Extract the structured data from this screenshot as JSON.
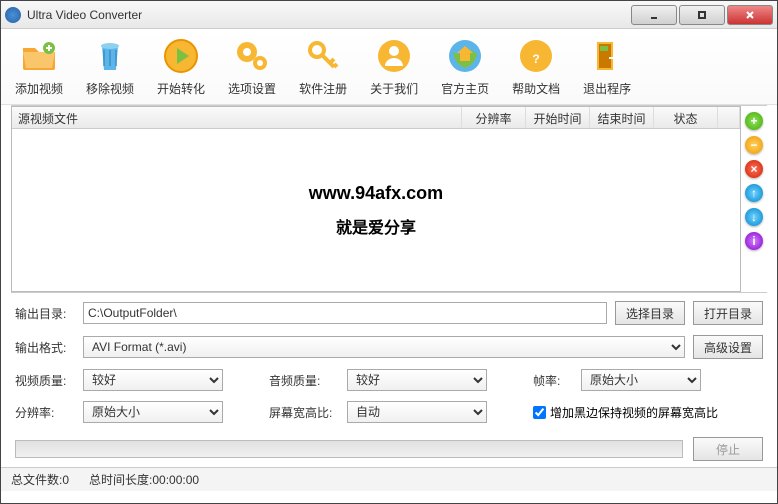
{
  "window": {
    "title": "Ultra Video Converter"
  },
  "toolbar": {
    "add": "添加视频",
    "remove": "移除视频",
    "start": "开始转化",
    "options": "选项设置",
    "register": "软件注册",
    "about": "关于我们",
    "homepage": "官方主页",
    "help": "帮助文档",
    "exit": "退出程序"
  },
  "table": {
    "col_source": "源视频文件",
    "col_res": "分辨率",
    "col_start": "开始时间",
    "col_end": "结束时间",
    "col_status": "状态",
    "watermark1": "www.94afx.com",
    "watermark2": "就是爱分享"
  },
  "sidebuttons": {
    "add": "+",
    "remove": "−",
    "delete": "×",
    "up": "↑",
    "down": "↓",
    "info": "i"
  },
  "form": {
    "outdir_label": "输出目录:",
    "outdir_value": "C:\\OutputFolder\\",
    "browse": "选择目录",
    "open": "打开目录",
    "outfmt_label": "输出格式:",
    "outfmt_value": "AVI Format (*.avi)",
    "advanced": "高级设置",
    "vquality_label": "视频质量:",
    "vquality_value": "较好",
    "aquality_label": "音频质量:",
    "aquality_value": "较好",
    "fps_label": "帧率:",
    "fps_value": "原始大小",
    "res_label": "分辨率:",
    "res_value": "原始大小",
    "aspect_label": "屏幕宽高比:",
    "aspect_value": "自动",
    "padding_label": "增加黑边保持视频的屏幕宽高比",
    "stop": "停止"
  },
  "status": {
    "filecount_label": "总文件数:",
    "filecount_value": "0",
    "duration_label": "总时间长度:",
    "duration_value": "00:00:00"
  }
}
